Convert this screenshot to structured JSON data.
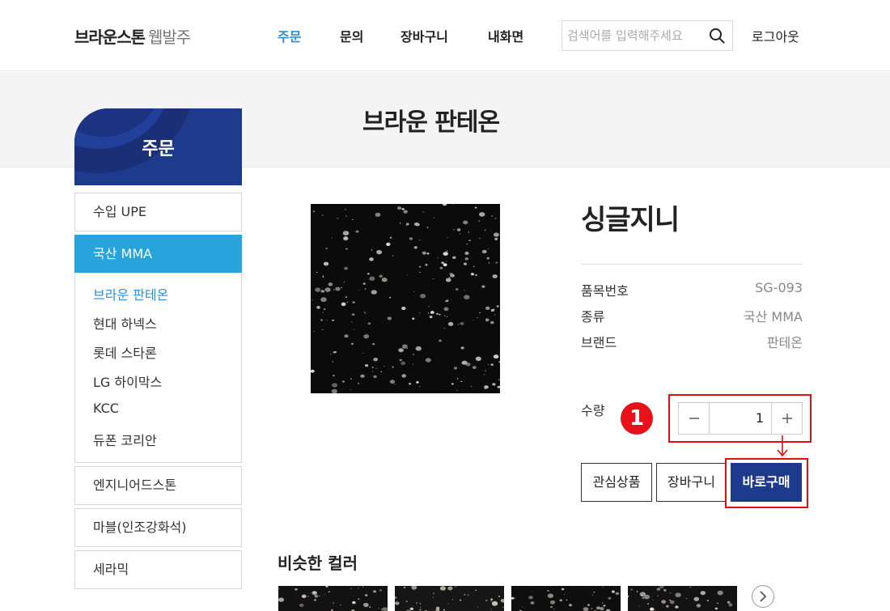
{
  "header": {
    "logo_main": "브라운스톤",
    "logo_sub": "웹발주",
    "nav": [
      "주문",
      "문의",
      "장바구니",
      "내화면"
    ],
    "search_placeholder": "검색어를 입력해주세요",
    "logout": "로그아웃"
  },
  "page_title": "브라운 판테온",
  "sidebar": {
    "title": "주문",
    "categories": [
      "수입 UPE",
      "국산 MMA",
      "엔지니어드스톤",
      "마블(인조강화석)",
      "세라믹"
    ],
    "active_category": "국산 MMA",
    "sub_items": [
      "브라운 판테온",
      "현대 하넥스",
      "롯데 스타론",
      "LG 하이막스",
      "KCC",
      "듀폰 코리안"
    ],
    "active_sub_item": "브라운 판테온"
  },
  "product": {
    "name": "싱글지니",
    "info": [
      {
        "label": "품목번호",
        "value": "SG-093"
      },
      {
        "label": "종류",
        "value": "국산 MMA"
      },
      {
        "label": "브랜드",
        "value": "판테온"
      }
    ],
    "quantity_label": "수량",
    "quantity": "1",
    "annotation_number": "1",
    "buttons": {
      "wishlist": "관심상품",
      "cart": "장바구니",
      "buy_now": "바로구매"
    }
  },
  "similar": {
    "title": "비슷한 컬러"
  },
  "colors": {
    "primary": "#1e3a8c",
    "accent": "#27a4dc",
    "nav_active": "#2a8fd8",
    "highlight": "#e01010"
  }
}
